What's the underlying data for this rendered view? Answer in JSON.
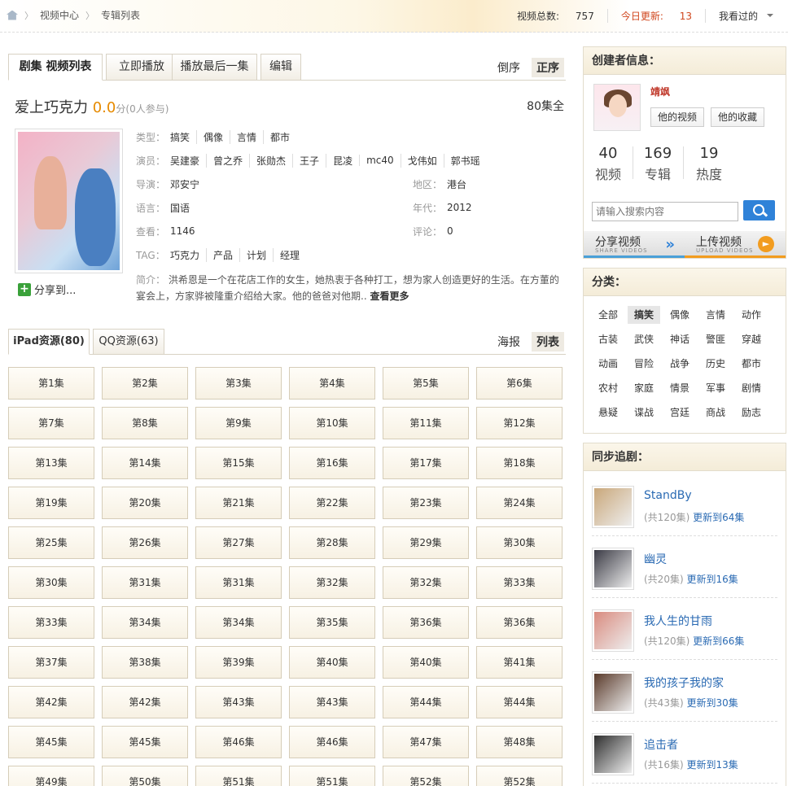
{
  "breadcrumb": {
    "home_icon": "home-icon",
    "items": [
      "视频中心",
      "专辑列表"
    ],
    "sep": "〉"
  },
  "header_stats": {
    "total_label": "视频总数:",
    "total_value": "757",
    "today_label": "今日更新:",
    "today_value": "13",
    "watched_label": "我看过的"
  },
  "tabs": [
    "剧集 视频列表",
    "立即播放",
    "播放最后一集",
    "编辑"
  ],
  "sort": {
    "desc": "倒序",
    "asc": "正序"
  },
  "album": {
    "title": "爱上巧克力",
    "score": "0.0",
    "score_unit": "分",
    "participants": "(0人参与)",
    "episodes_total": "80集全",
    "share_label": "分享到...",
    "type_label": "类型：",
    "types": [
      "搞笑",
      "偶像",
      "言情",
      "都市"
    ],
    "actors_label": "演员：",
    "actors": [
      "吴建豪",
      "曾之乔",
      "张勋杰",
      "王子",
      "昆凌",
      "mc40",
      "戈伟如",
      "郭书瑶"
    ],
    "director_label": "导演：",
    "director": "邓安宁",
    "region_label": "地区：",
    "region": "港台",
    "language_label": "语言：",
    "language": "国语",
    "year_label": "年代：",
    "year": "2012",
    "views_label": "查看：",
    "views": "1146",
    "comments_label": "评论：",
    "comments": "0",
    "tag_label": "TAG：",
    "tags": [
      "巧克力",
      "产品",
      "计划",
      "经理"
    ],
    "intro_label": "简介：",
    "intro": "洪希恩是一个在花店工作的女生，她热衷于各种打工，想为家人创造更好的生活。在方董的宴会上，方家骅被隆重介绍给大家。他的爸爸对他期..",
    "more": "查看更多"
  },
  "source_tabs": [
    "iPad资源(80)",
    "QQ资源(63)"
  ],
  "view_modes": {
    "poster": "海报",
    "list": "列表"
  },
  "episodes": [
    "第1集",
    "第2集",
    "第3集",
    "第4集",
    "第5集",
    "第6集",
    "第7集",
    "第8集",
    "第9集",
    "第10集",
    "第11集",
    "第12集",
    "第13集",
    "第14集",
    "第15集",
    "第16集",
    "第17集",
    "第18集",
    "第19集",
    "第20集",
    "第21集",
    "第22集",
    "第23集",
    "第24集",
    "第25集",
    "第26集",
    "第27集",
    "第28集",
    "第29集",
    "第30集",
    "第30集",
    "第31集",
    "第31集",
    "第32集",
    "第32集",
    "第33集",
    "第33集",
    "第34集",
    "第34集",
    "第35集",
    "第36集",
    "第36集",
    "第37集",
    "第38集",
    "第39集",
    "第40集",
    "第40集",
    "第41集",
    "第42集",
    "第42集",
    "第43集",
    "第43集",
    "第44集",
    "第44集",
    "第45集",
    "第45集",
    "第46集",
    "第46集",
    "第47集",
    "第48集",
    "第49集",
    "第50集",
    "第51集",
    "第51集",
    "第52集",
    "第52集"
  ],
  "creator": {
    "heading": "创建者信息：",
    "name": "靖飒",
    "videos_btn": "他的视频",
    "favs_btn": "他的收藏",
    "stats": [
      {
        "n": "40",
        "l": "视频"
      },
      {
        "n": "169",
        "l": "专辑"
      },
      {
        "n": "19",
        "l": "热度"
      }
    ],
    "search_placeholder": "请输入搜索内容",
    "share_title": "分享视频",
    "share_sub": "SHARE VIDEOS",
    "upload_title": "上传视频",
    "upload_sub": "UPLOAD VIDEOS"
  },
  "categories": {
    "heading": "分类：",
    "active": "搞笑",
    "items": [
      "全部",
      "搞笑",
      "偶像",
      "言情",
      "动作",
      "古装",
      "武侠",
      "神话",
      "警匪",
      "穿越",
      "动画",
      "冒险",
      "战争",
      "历史",
      "都市",
      "农村",
      "家庭",
      "情景",
      "军事",
      "剧情",
      "悬疑",
      "谍战",
      "宫廷",
      "商战",
      "励志"
    ]
  },
  "following": {
    "heading": "同步追剧：",
    "items": [
      {
        "title": "StandBy",
        "count": "(共120集)",
        "update": "更新到64集",
        "color": "#c9a77a"
      },
      {
        "title": "幽灵",
        "count": "(共20集)",
        "update": "更新到16集",
        "color": "#3b3b45"
      },
      {
        "title": "我人生的甘雨",
        "count": "(共120集)",
        "update": "更新到66集",
        "color": "#d98b7f"
      },
      {
        "title": "我的孩子我的家",
        "count": "(共43集)",
        "update": "更新到30集",
        "color": "#5a3a2a"
      },
      {
        "title": "追击者",
        "count": "(共16集)",
        "update": "更新到13集",
        "color": "#2e2e2e"
      }
    ]
  }
}
